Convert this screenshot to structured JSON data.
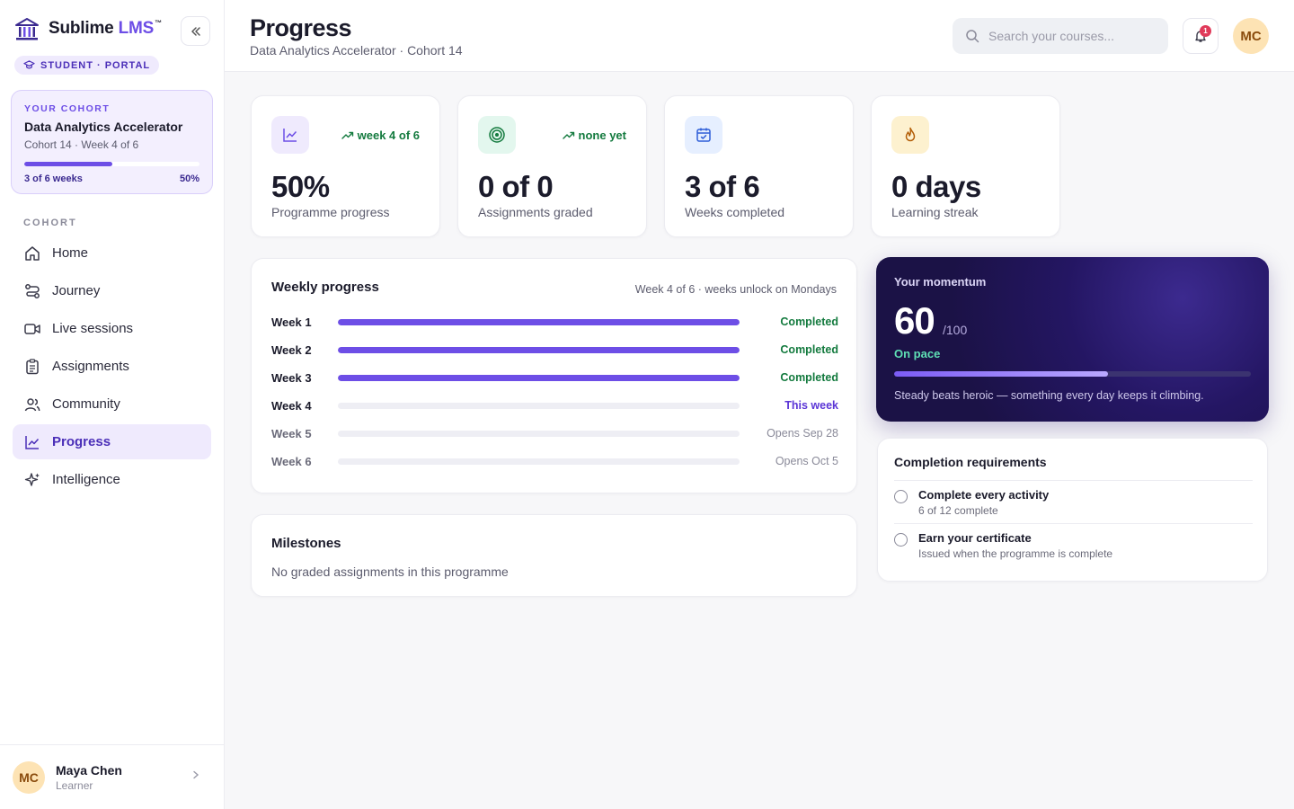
{
  "brand": {
    "name": "Sublime",
    "accent": "LMS",
    "tm": "™",
    "portal": "STUDENT · PORTAL"
  },
  "cohort_card": {
    "kicker": "YOUR COHORT",
    "title": "Data Analytics Accelerator",
    "subtitle": "Cohort 14 · Week 4 of 6",
    "progress_fraction": 0.5,
    "progress_text": "3 of 6 weeks",
    "percent": "50%"
  },
  "nav": {
    "heading": "COHORT",
    "items": [
      {
        "label": "Home",
        "icon": "home-icon"
      },
      {
        "label": "Journey",
        "icon": "route-icon"
      },
      {
        "label": "Live sessions",
        "icon": "video-icon"
      },
      {
        "label": "Assignments",
        "icon": "clipboard-icon"
      },
      {
        "label": "Community",
        "icon": "users-icon"
      },
      {
        "label": "Progress",
        "icon": "chart-line-icon",
        "active": true
      },
      {
        "label": "Intelligence",
        "icon": "sparkles-icon"
      }
    ]
  },
  "user": {
    "initials": "MC",
    "name": "Maya Chen",
    "role": "Learner"
  },
  "header": {
    "title": "Progress",
    "subtitle": "Data Analytics Accelerator · Cohort 14",
    "search_placeholder": "Search your courses...",
    "notification_count": "1",
    "avatar_initials": "MC"
  },
  "stats": [
    {
      "value": "50%",
      "label": "Programme progress",
      "trend": "week 4 of 6",
      "icon": "chart-line-icon",
      "icon_bg": "#efeafd",
      "icon_color": "#6d4ee6"
    },
    {
      "value": "0 of 0",
      "label": "Assignments graded",
      "trend": "none yet",
      "icon": "target-icon",
      "icon_bg": "#e3f7ee",
      "icon_color": "#137a3e"
    },
    {
      "value": "3 of 6",
      "label": "Weeks completed",
      "trend": "",
      "icon": "calendar-check-icon",
      "icon_bg": "#e6efff",
      "icon_color": "#2f5fd8"
    },
    {
      "value": "0 days",
      "label": "Learning streak",
      "trend": "",
      "icon": "flame-icon",
      "icon_bg": "#fdf1cf",
      "icon_color": "#b25d06"
    }
  ],
  "weekly": {
    "title": "Weekly progress",
    "meta": "Week 4 of 6 · weeks unlock on Mondays",
    "weeks": [
      {
        "label": "Week 1",
        "status": "Completed",
        "progress": 1,
        "kind": "done"
      },
      {
        "label": "Week 2",
        "status": "Completed",
        "progress": 1,
        "kind": "done"
      },
      {
        "label": "Week 3",
        "status": "Completed",
        "progress": 1,
        "kind": "done"
      },
      {
        "label": "Week 4",
        "status": "This week",
        "progress": 0,
        "kind": "current"
      },
      {
        "label": "Week 5",
        "status": "Opens Sep 28",
        "progress": 0,
        "kind": "future"
      },
      {
        "label": "Week 6",
        "status": "Opens Oct 5",
        "progress": 0,
        "kind": "future"
      }
    ]
  },
  "milestones": {
    "title": "Milestones",
    "empty": "No graded assignments in this programme"
  },
  "momentum": {
    "title": "Your momentum",
    "score": "60",
    "max": "/100",
    "status": "On pace",
    "progress_fraction": 0.6,
    "message": "Steady beats heroic — something every day keeps it climbing."
  },
  "requirements": {
    "title": "Completion requirements",
    "items": [
      {
        "name": "Complete every activity",
        "detail": "6 of 12 complete"
      },
      {
        "name": "Earn your certificate",
        "detail": "Issued when the programme is complete"
      }
    ]
  },
  "colors": {
    "accent": "#6d4ee6",
    "success": "#137a3e",
    "momentum_bg": "#1b1246"
  }
}
